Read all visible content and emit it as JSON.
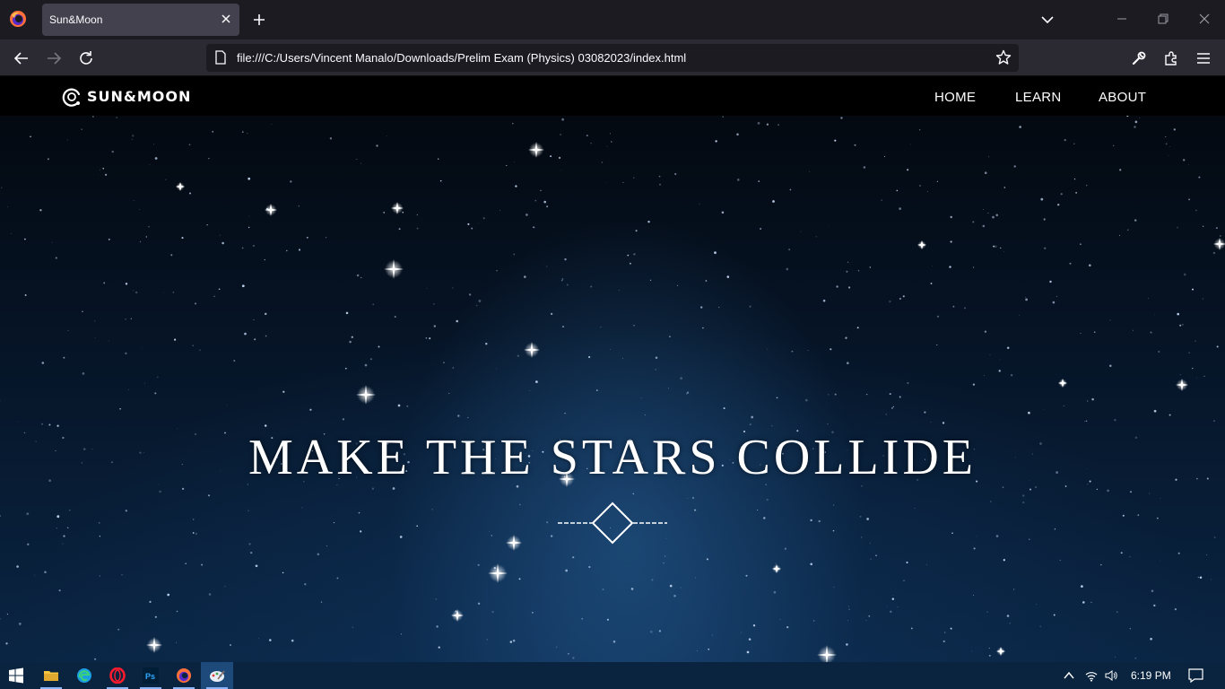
{
  "browser": {
    "tab_title": "Sun&Moon",
    "url": "file:///C:/Users/Vincent Manalo/Downloads/Prelim Exam (Physics) 03082023/index.html"
  },
  "site": {
    "brand": "SUN&MOON",
    "nav": [
      "HOME",
      "LEARN",
      "ABOUT"
    ],
    "hero_title": "MAKE THE STARS COLLIDE"
  },
  "taskbar": {
    "clock": "6:19 PM",
    "apps": [
      "start-icon",
      "file-explorer-icon",
      "edge-icon",
      "opera-icon",
      "photoshop-icon",
      "firefox-icon",
      "paint-icon"
    ]
  },
  "colors": {
    "browser_bg": "#1c1b22",
    "tab_active": "#42414d",
    "toolbar_bg": "#2b2a33",
    "site_header": "#000000",
    "sky_accent": "#0a2544",
    "taskbar_bg": "#0a2440"
  }
}
